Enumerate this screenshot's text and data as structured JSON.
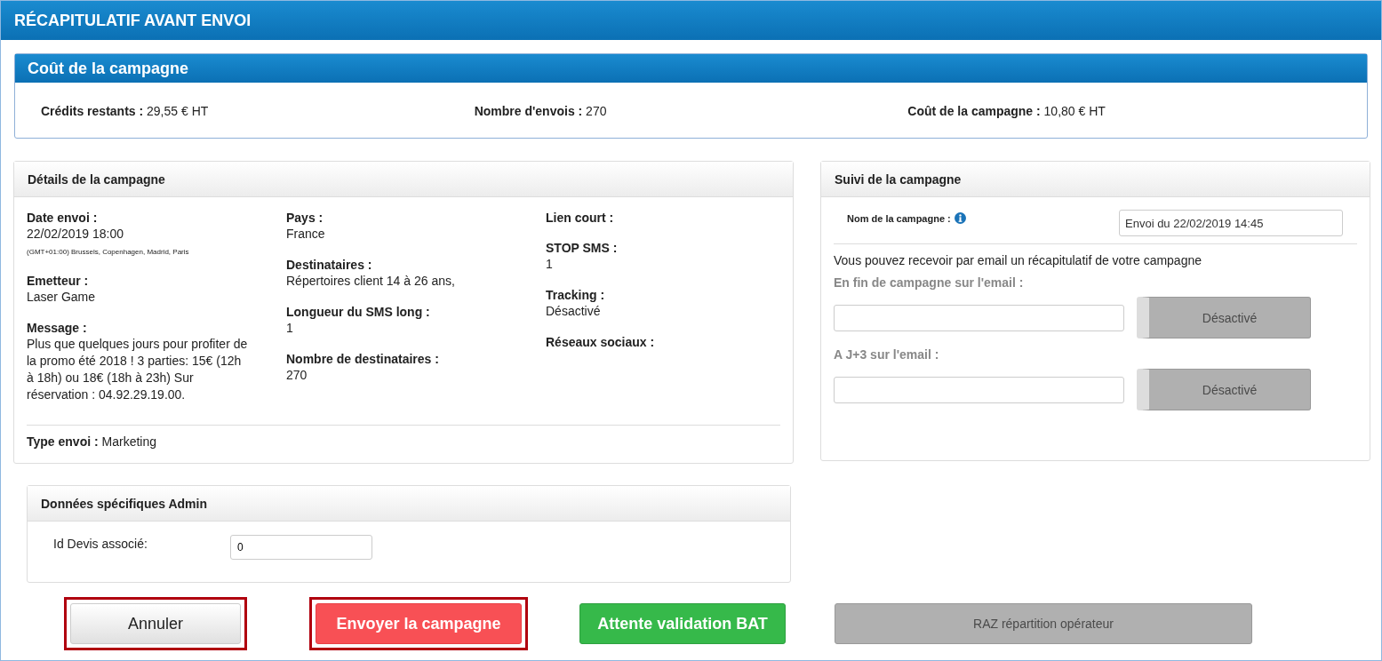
{
  "title": "RÉCAPITULATIF AVANT ENVOI",
  "cost": {
    "title": "Coût de la campagne",
    "items": [
      {
        "label": "Crédits restants :",
        "value": "29,55 € HT"
      },
      {
        "label": "Nombre d'envois :",
        "value": "270"
      },
      {
        "label": "Coût de la campagne :",
        "value": "10,80 € HT"
      }
    ]
  },
  "details": {
    "title": "Détails de la campagne",
    "columns": [
      [
        {
          "label": "Date envoi :",
          "value": "22/02/2019 18:00",
          "note": "(GMT+01:00) Brussels, Copenhagen, Madrid, Paris"
        },
        {
          "label": "Emetteur :",
          "value": "Laser Game"
        },
        {
          "label": "Message :",
          "value": "Plus que quelques jours pour profiter de la promo été 2018 ! 3 parties: 15€ (12h à 18h) ou 18€ (18h à 23h) Sur réservation : 04.92.29.19.00."
        }
      ],
      [
        {
          "label": "Pays :",
          "value": "France"
        },
        {
          "label": "Destinataires :",
          "value": "Répertoires client 14 à 26 ans,"
        },
        {
          "label": "Longueur du SMS long :",
          "value": "1"
        },
        {
          "label": "Nombre de destinataires :",
          "value": "270"
        }
      ],
      [
        {
          "label": "Lien court :"
        },
        {
          "label": "STOP SMS :",
          "value": "1"
        },
        {
          "label": "Tracking :",
          "value": "Désactivé"
        },
        {
          "label": "Réseaux sociaux :"
        }
      ]
    ],
    "type_label": "Type envoi :",
    "type_value": "Marketing"
  },
  "tracking": {
    "title": "Suivi de la campagne",
    "name_label": "Nom de la campagne :",
    "name_value": "Envoi du 22/02/2019 14:45",
    "intro": "Vous pouvez recevoir par email un récapitulatif de votre campagne",
    "emails": [
      {
        "label": "En fin de campagne sur l'email :",
        "toggle": "Désactivé",
        "on": false
      },
      {
        "label": "A J+3 sur l'email :",
        "toggle": "Désactivé",
        "on": false
      }
    ]
  },
  "admin": {
    "title": "Données spécifiques Admin",
    "label": "Id Devis associé:",
    "value": "0"
  },
  "buttons": [
    {
      "label": "Annuler",
      "kind": "default",
      "disabled": false,
      "highlighted": true
    },
    {
      "label": "Envoyer la campagne",
      "kind": "danger",
      "disabled": false,
      "highlighted": true
    },
    {
      "label": "Attente validation BAT",
      "kind": "success",
      "disabled": false,
      "highlighted": false
    },
    {
      "label": "RAZ répartition opérateur",
      "kind": "default",
      "disabled": true,
      "highlighted": false
    }
  ]
}
